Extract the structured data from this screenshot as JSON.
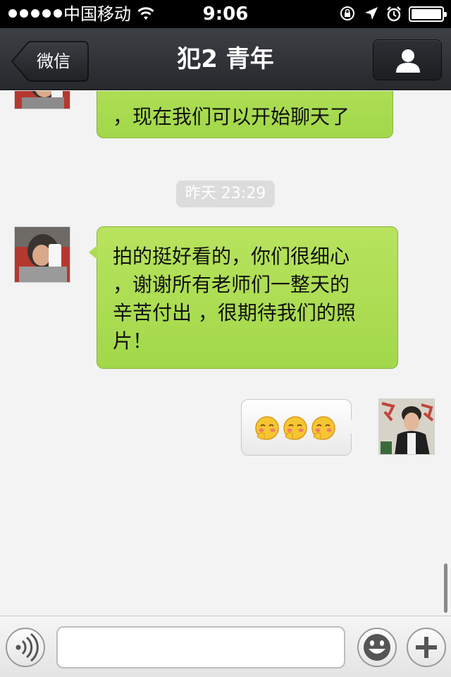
{
  "status_bar": {
    "carrier": "中国移动",
    "time": "9:06",
    "icons": [
      "signal-dots-icon",
      "wifi-icon",
      "rotation-lock-icon",
      "location-arrow-icon",
      "alarm-icon",
      "battery-icon"
    ]
  },
  "nav": {
    "back_label": "微信",
    "title": "犯2 青年",
    "profile_icon": "person-icon"
  },
  "chat": {
    "messages": [
      {
        "side": "left",
        "type": "text",
        "text": "，现在我们可以开始聊天了"
      },
      {
        "type": "timestamp",
        "text": "昨天 23:29"
      },
      {
        "side": "left",
        "type": "text",
        "text": "拍的挺好看的，你们很细心\n，谢谢所有老师们一整天的\n辛苦付出 ，很期待我们的照\n片！"
      },
      {
        "side": "right",
        "type": "emoji",
        "emoji": [
          "blush-emoji",
          "blush-emoji",
          "blush-emoji"
        ]
      }
    ]
  },
  "input_bar": {
    "voice_icon": "voice-icon",
    "text_value": "",
    "emoji_icon": "smiley-icon",
    "plus_icon": "plus-icon"
  },
  "colors": {
    "nav_bg": "#2e3034",
    "bubble_green": "#a9db4f",
    "chat_bg": "#f3f3f3"
  }
}
